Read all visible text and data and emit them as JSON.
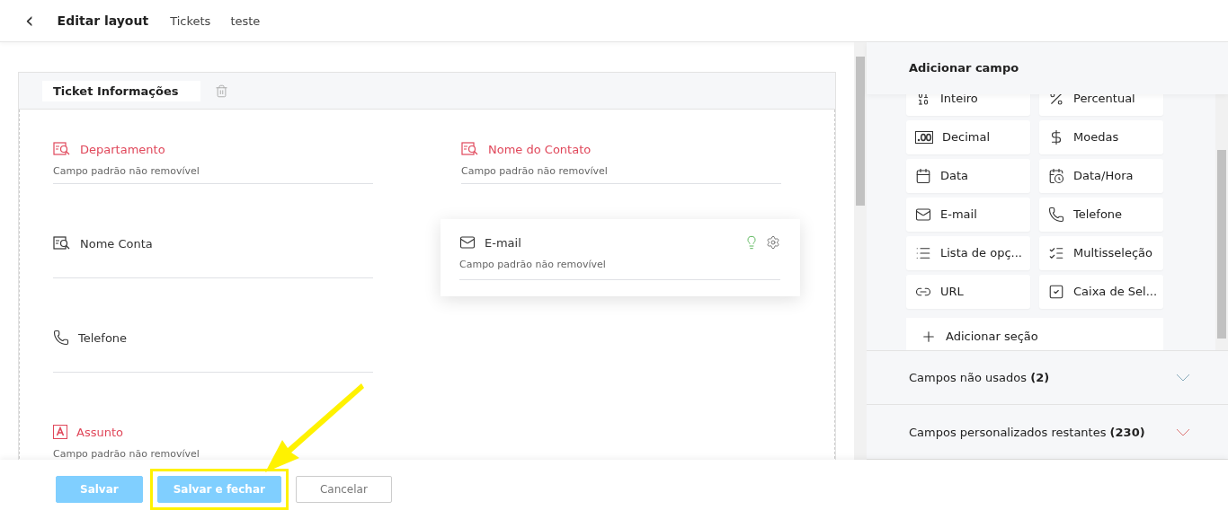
{
  "header": {
    "back": "‹",
    "title": "Editar layout",
    "breadcrumbs": [
      "Tickets",
      "teste"
    ]
  },
  "section": {
    "title": "Ticket Informações",
    "columns": [
      [
        {
          "label": "Departamento",
          "hint": "Campo padrão não removível",
          "required": true,
          "kind": "lookup"
        },
        {
          "label": "Nome Conta",
          "required": false,
          "kind": "lookup"
        },
        {
          "label": "Telefone",
          "required": false,
          "kind": "phone"
        },
        {
          "label": "Assunto",
          "hint": "Campo padrão não removível",
          "required": true,
          "kind": "text"
        }
      ],
      [
        {
          "label": "Nome do Contato",
          "hint": "Campo padrão não removível",
          "required": true,
          "kind": "lookup"
        }
      ]
    ]
  },
  "dragged_field": {
    "label": "E-mail",
    "hint": "Campo padrão não removível",
    "kind": "email"
  },
  "palette": {
    "title": "Adicionar campo",
    "items": [
      {
        "label": "Inteiro",
        "kind": "integer"
      },
      {
        "label": "Percentual",
        "kind": "percent"
      },
      {
        "label": "Decimal",
        "kind": "decimal"
      },
      {
        "label": "Moedas",
        "kind": "currency"
      },
      {
        "label": "Data",
        "kind": "date"
      },
      {
        "label": "Data/Hora",
        "kind": "datetime"
      },
      {
        "label": "E-mail",
        "kind": "email"
      },
      {
        "label": "Telefone",
        "kind": "phone"
      },
      {
        "label": "Lista de opç...",
        "kind": "picklist"
      },
      {
        "label": "Multisseleção",
        "kind": "multiselect"
      },
      {
        "label": "URL",
        "kind": "url"
      },
      {
        "label": "Caixa de Sel...",
        "kind": "checkbox"
      }
    ],
    "add_section": "Adicionar seção"
  },
  "accordions": [
    {
      "label": "Campos não usados **(2)**",
      "expanded": false
    },
    {
      "label": "Campos personalizados restantes **(230)**",
      "expanded": false
    }
  ],
  "footer": {
    "buttons": [
      {
        "label": "Salvar",
        "kind": "primary",
        "highlighted": false
      },
      {
        "label": "Salvar e fechar",
        "kind": "primary",
        "highlighted": true
      },
      {
        "label": "Cancelar",
        "kind": "secondary",
        "highlighted": false
      }
    ]
  }
}
